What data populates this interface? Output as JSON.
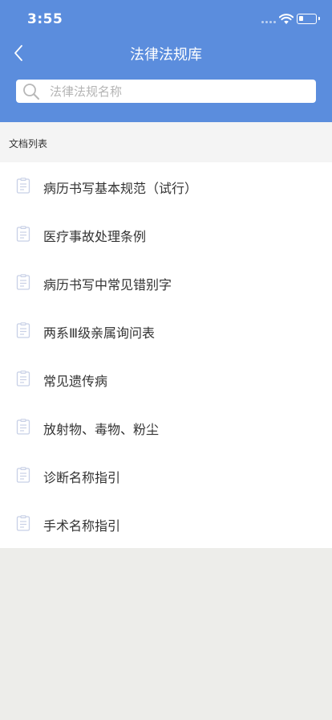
{
  "status_bar": {
    "time": "3:55",
    "battery_level": 0.3
  },
  "nav": {
    "title": "法律法规库"
  },
  "search": {
    "placeholder": "法律法规名称",
    "value": ""
  },
  "section": {
    "title": "文档列表"
  },
  "documents": [
    {
      "label": "病历书写基本规范（试行）"
    },
    {
      "label": "医疗事故处理条例"
    },
    {
      "label": "病历书写中常见错别字"
    },
    {
      "label": "两系Ⅲ级亲属询问表"
    },
    {
      "label": "常见遗传病"
    },
    {
      "label": "放射物、毒物、粉尘"
    },
    {
      "label": "诊断名称指引"
    },
    {
      "label": "手术名称指引"
    }
  ],
  "colors": {
    "header": "#5b8ddd",
    "icon": "#c8d0e6",
    "text": "#333333"
  }
}
